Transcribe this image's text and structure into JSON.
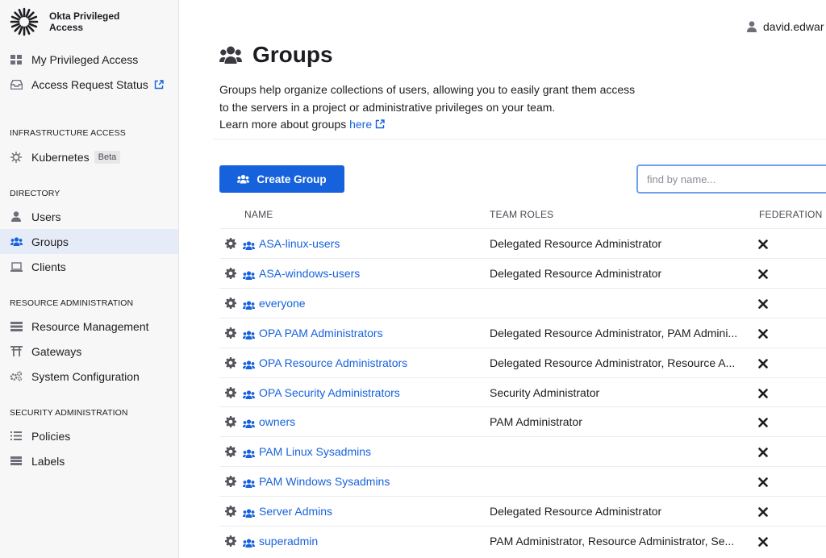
{
  "app": {
    "brand_line1": "Okta Privileged",
    "brand_line2": "Access"
  },
  "sidebar": {
    "top_items": [
      {
        "label": "My Privileged Access",
        "icon": "grid-icon"
      },
      {
        "label": "Access Request Status",
        "icon": "inbox-icon",
        "external": true
      }
    ],
    "sections": [
      {
        "heading": "INFRASTRUCTURE ACCESS",
        "items": [
          {
            "label": "Kubernetes",
            "badge": "Beta",
            "icon": "helm-icon"
          }
        ]
      },
      {
        "heading": "DIRECTORY",
        "items": [
          {
            "label": "Users",
            "icon": "user-icon"
          },
          {
            "label": "Groups",
            "icon": "users-icon",
            "active": true
          },
          {
            "label": "Clients",
            "icon": "laptop-icon"
          }
        ]
      },
      {
        "heading": "RESOURCE ADMINISTRATION",
        "items": [
          {
            "label": "Resource Management",
            "icon": "server-icon"
          },
          {
            "label": "Gateways",
            "icon": "gateway-icon"
          },
          {
            "label": "System Configuration",
            "icon": "cogs-icon"
          }
        ]
      },
      {
        "heading": "SECURITY ADMINISTRATION",
        "items": [
          {
            "label": "Policies",
            "icon": "list-icon"
          },
          {
            "label": "Labels",
            "icon": "labels-icon"
          }
        ]
      }
    ]
  },
  "header": {
    "username": "david.edwar"
  },
  "page": {
    "title": "Groups",
    "description": "Groups help organize collections of users, allowing you to easily grant them access to the servers in a project or administrative privileges on your team.",
    "learn_more_prefix": "Learn more about groups",
    "learn_more_link": "here"
  },
  "toolbar": {
    "create_label": "Create Group",
    "search_placeholder": "find by name..."
  },
  "table": {
    "columns": {
      "name": "NAME",
      "roles": "TEAM ROLES",
      "federation": "FEDERATION"
    },
    "rows": [
      {
        "name": "ASA-linux-users",
        "roles": "Delegated Resource Administrator"
      },
      {
        "name": "ASA-windows-users",
        "roles": "Delegated Resource Administrator"
      },
      {
        "name": "everyone",
        "roles": ""
      },
      {
        "name": "OPA PAM Administrators",
        "roles": "Delegated Resource Administrator, PAM Admini..."
      },
      {
        "name": "OPA Resource Administrators",
        "roles": "Delegated Resource Administrator, Resource A..."
      },
      {
        "name": "OPA Security Administrators",
        "roles": "Security Administrator"
      },
      {
        "name": "owners",
        "roles": "PAM Administrator"
      },
      {
        "name": "PAM Linux Sysadmins",
        "roles": ""
      },
      {
        "name": "PAM Windows Sysadmins",
        "roles": ""
      },
      {
        "name": "Server Admins",
        "roles": "Delegated Resource Administrator"
      },
      {
        "name": "superadmin",
        "roles": "PAM Administrator, Resource Administrator, Se..."
      }
    ]
  },
  "colors": {
    "accent": "#1662dd",
    "sidebar_bg": "#f7f7f8",
    "active_bg": "#e6ecf7"
  }
}
